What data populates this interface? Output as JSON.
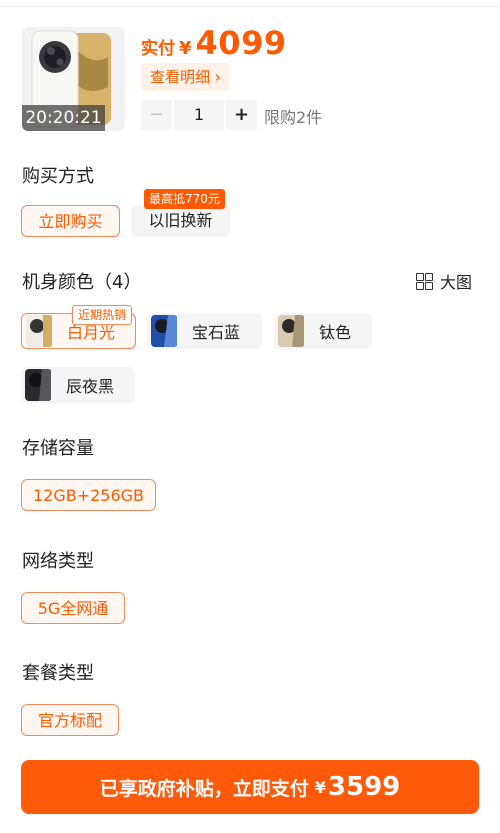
{
  "product": {
    "timer": "20:20:21",
    "price_label": "实付",
    "currency": "¥",
    "price": "4099",
    "detail_label": "查看明细",
    "detail_chevron": "›",
    "quantity": "1",
    "minus": "−",
    "plus": "+",
    "limit_text": "限购2件",
    "image_icon": "phone-product-image"
  },
  "purchase": {
    "title": "购买方式",
    "options": [
      {
        "label": "立即购买",
        "selected": true
      },
      {
        "label": "以旧换新",
        "selected": false,
        "badge": "最高抵770元"
      }
    ]
  },
  "colors": {
    "title": "机身颜色（4）",
    "big_pic_label": "大图",
    "big_pic_icon": "grid-icon",
    "options": [
      {
        "label": "白月光",
        "selected": true,
        "badge": "近期热销",
        "swatch": "#e8e4dc"
      },
      {
        "label": "宝石蓝",
        "selected": false,
        "swatch": "#2d5fb8"
      },
      {
        "label": "钛色",
        "selected": false,
        "swatch": "#c9b79a"
      },
      {
        "label": "辰夜黑",
        "selected": false,
        "swatch": "#2a2a2e"
      }
    ]
  },
  "storage": {
    "title": "存储容量",
    "options": [
      {
        "label": "12GB+256GB",
        "selected": true
      }
    ]
  },
  "network": {
    "title": "网络类型",
    "options": [
      {
        "label": "5G全网通",
        "selected": true
      }
    ]
  },
  "package": {
    "title": "套餐类型",
    "options": [
      {
        "label": "官方标配",
        "selected": true
      }
    ]
  },
  "cta": {
    "text": "已享政府补贴，立即支付",
    "currency": "¥",
    "price": "3599"
  },
  "accent_color": "#ff5a00"
}
